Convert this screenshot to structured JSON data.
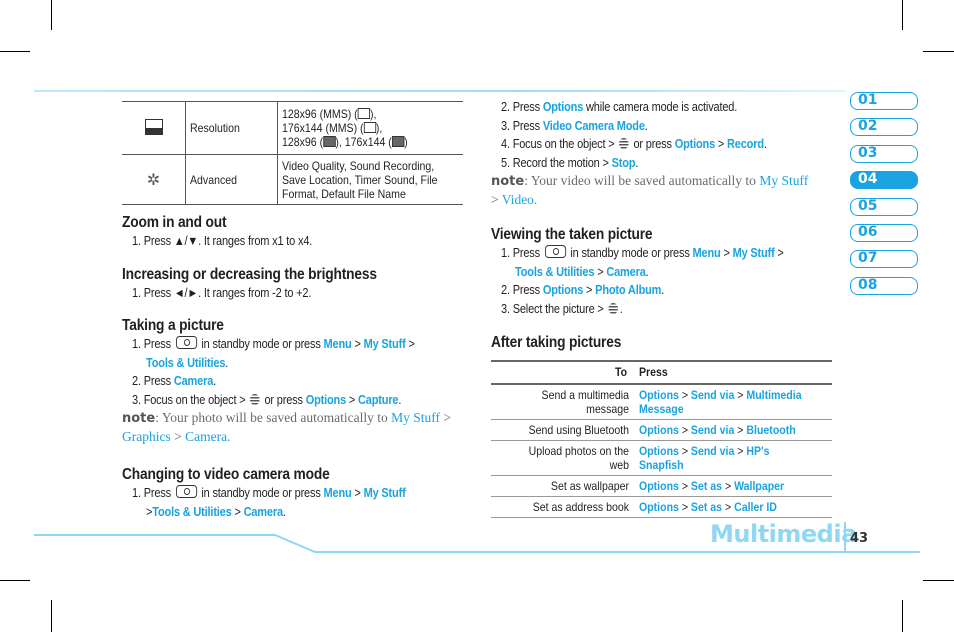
{
  "options_table": {
    "rows": [
      {
        "icon": "size-icon",
        "name": "Resolution",
        "lines": [
          "128x96 (MMS) (",
          "), ",
          "176x144 (MMS) (",
          "), ",
          "128x96 (",
          "), 176x144 (",
          ")"
        ]
      },
      {
        "icon": "gear-icon",
        "name": "Advanced",
        "lines": [
          "Video Quality, Sound Recording,",
          "Save Location, Timer Sound, File",
          "Format, Default File Name"
        ]
      }
    ]
  },
  "left": {
    "zoom": {
      "title": "Zoom in and out",
      "step1": "1. Press ▲/▼. It ranges from x1 to x4."
    },
    "brightness": {
      "title": "Increasing or decreasing the brightness",
      "step1": "1. Press ◄/►. It ranges from -2 to +2."
    },
    "taking": {
      "title": "Taking a picture",
      "s1a": "1. Press",
      "s1b": "in standby mode or press",
      "menu": "Menu",
      "gt": ">",
      "mystuff": "My Stuff",
      "tools": "Tools & Utilities",
      "s2": "2. Press",
      "camera": "Camera",
      "s3a": "3. Focus on the object >",
      "s3b": "or press",
      "options": "Options",
      "capture": "Capture",
      "note_label": "note",
      "note_text": ": Your photo will be saved automatically to",
      "note_l1": "My Stuff",
      "note_l2": "Graphics",
      "note_l3": "Camera."
    },
    "video": {
      "title": "Changing to video camera mode",
      "s1a": "1. Press",
      "s1b": "in standby mode or press",
      "menu": "Menu",
      "mystuff": "My Stuff",
      "tools": "Tools & Utilities",
      "camera": "Camera"
    }
  },
  "right": {
    "video_cont": {
      "s2a": "2. Press",
      "options": "Options",
      "s2b": "while camera mode is activated.",
      "s3a": "3. Press",
      "vcm": "Video Camera Mode",
      "s4a": "4. Focus on the object >",
      "s4b": "or press",
      "record": "Record",
      "s5a": "5. Record the motion >",
      "stop": "Stop",
      "note_label": "note",
      "note_text": ": Your video will be saved automatically to",
      "note_l1": "My Stuff",
      "note_l2": "Video."
    },
    "viewing": {
      "title": "Viewing the taken picture",
      "s1a": "1. Press",
      "s1b": "in standby mode or press",
      "menu": "Menu",
      "mystuff": "My Stuff",
      "tools": "Tools & Utilities",
      "camera": "Camera",
      "s2a": "2. Press",
      "options": "Options",
      "album": "Photo Album",
      "s3a": "3. Select the picture >"
    },
    "after": {
      "title": "After taking pictures",
      "header": {
        "to": "To",
        "press": "Press"
      },
      "rows": [
        {
          "to": "Send a multimedia message",
          "press": [
            "Options",
            "Send via",
            "Multimedia Message"
          ]
        },
        {
          "to": "Send using Bluetooth",
          "press": [
            "Options",
            "Send via",
            "Bluetooth"
          ]
        },
        {
          "to": "Upload photos on the web",
          "press": [
            "Options",
            "Send via",
            "HP's Snapfish"
          ]
        },
        {
          "to": "Set as wallpaper",
          "press": [
            "Options",
            "Set as",
            "Wallpaper"
          ]
        },
        {
          "to": "Set as address book",
          "press": [
            "Options",
            "Set as",
            "Caller ID"
          ]
        }
      ]
    }
  },
  "chapters": {
    "items": [
      "01",
      "02",
      "03",
      "04",
      "05",
      "06",
      "07",
      "08"
    ],
    "active": "04",
    "accent": "#1aa3e0"
  },
  "footer": {
    "section": "Multimedia",
    "page": "43"
  }
}
